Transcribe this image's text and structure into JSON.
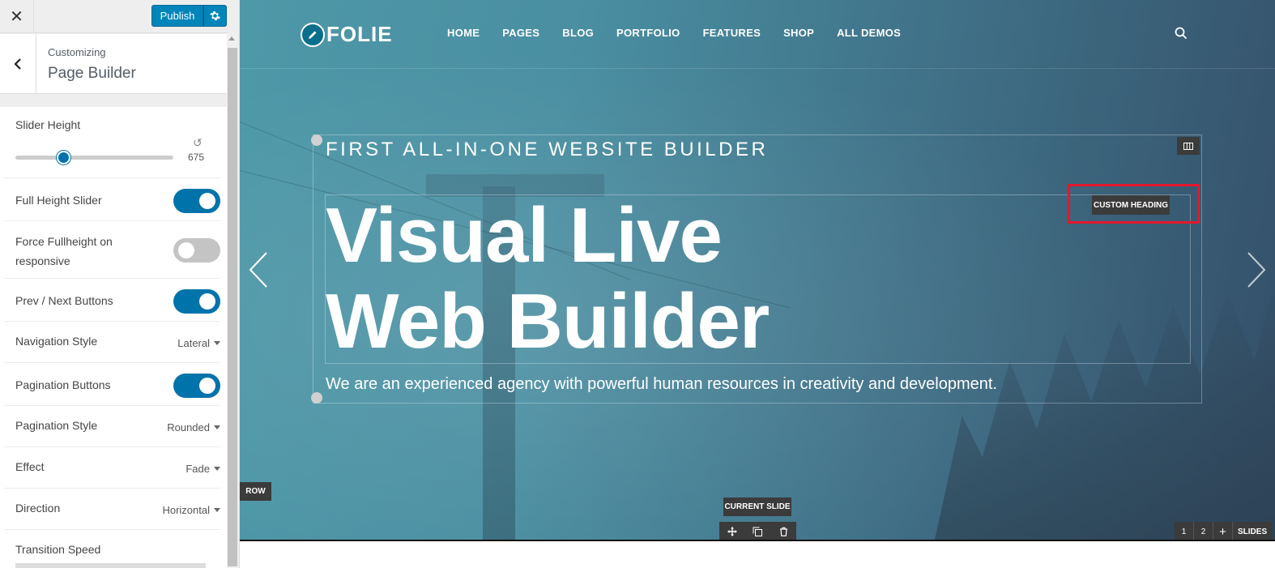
{
  "topbar": {
    "close_glyph": "✕",
    "publish_label": "Publish",
    "gear_icon": "gear-icon"
  },
  "panel": {
    "small": "Customizing",
    "title": "Page Builder"
  },
  "controls": {
    "slider_height": {
      "label": "Slider Height",
      "value": "675",
      "fraction": 0.3
    },
    "full_height": {
      "label": "Full Height Slider",
      "on": true
    },
    "force_fullheight": {
      "label": "Force Fullheight on responsive",
      "on": false
    },
    "prev_next": {
      "label": "Prev / Next Buttons",
      "on": true
    },
    "navigation_style": {
      "label": "Navigation Style",
      "value": "Lateral"
    },
    "pagination_buttons": {
      "label": "Pagination Buttons",
      "on": true
    },
    "pagination_style": {
      "label": "Pagination Style",
      "value": "Rounded"
    },
    "effect": {
      "label": "Effect",
      "value": "Fade"
    },
    "direction": {
      "label": "Direction",
      "value": "Horizontal"
    },
    "transition_speed": {
      "label": "Transition Speed"
    }
  },
  "site": {
    "logo_text": "FOLIE",
    "logo_badge": "wp",
    "nav": [
      "HOME",
      "PAGES",
      "BLOG",
      "PORTFOLIO",
      "FEATURES",
      "SHOP",
      "ALL DEMOS"
    ]
  },
  "slide": {
    "kicker": "FIRST ALL-IN-ONE WEBSITE BUILDER",
    "heading_line1": "Visual Live",
    "heading_line2": "Web Builder",
    "subtext": "We are an experienced agency with powerful human resources in creativity and development."
  },
  "builder": {
    "custom_heading": "CUSTOM HEADING",
    "row": "ROW",
    "current_slide": "CURRENT SLIDE",
    "slide_1": "1",
    "slide_2": "2",
    "add": "+",
    "slides": "SLIDES"
  },
  "colors": {
    "accent": "#0073aa",
    "publish": "#0085ba",
    "highlight": "#e3182d",
    "toolbar": "#3b3b3b"
  }
}
